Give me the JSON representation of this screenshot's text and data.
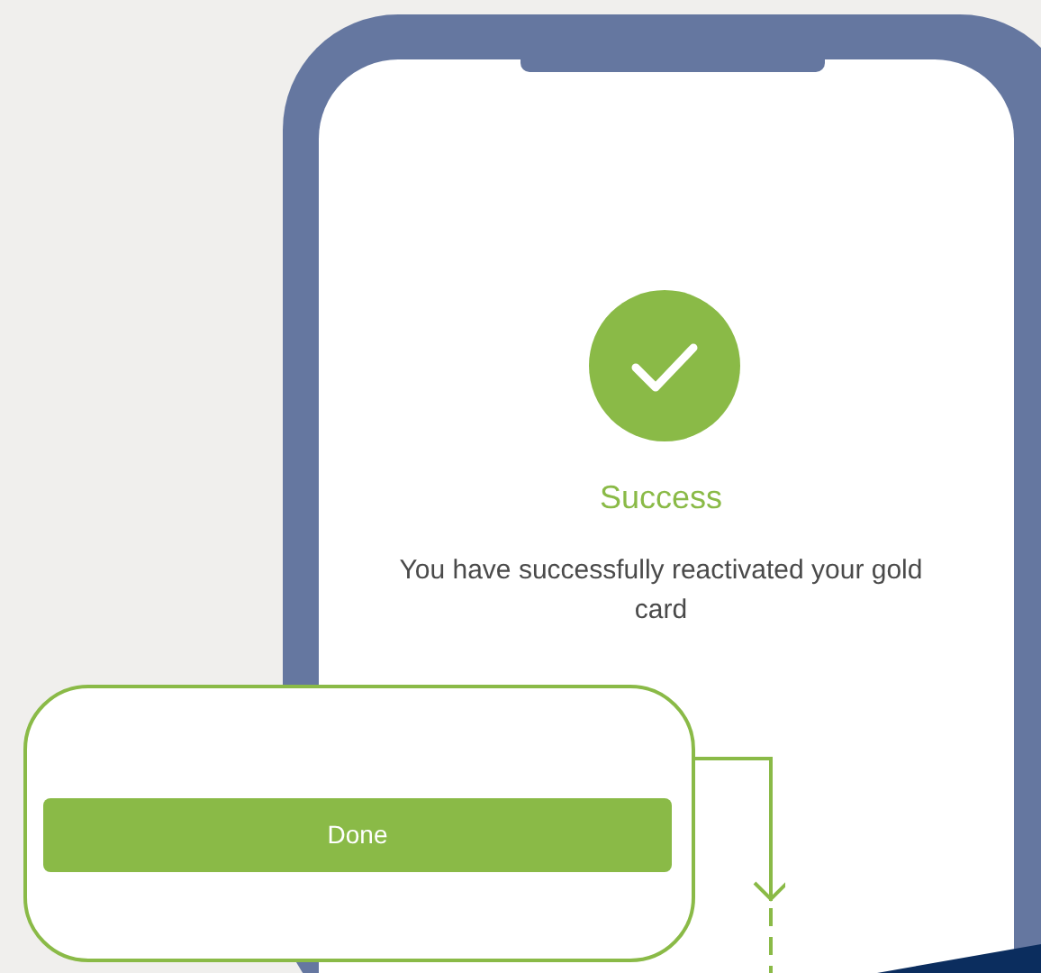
{
  "screen": {
    "title": "Success",
    "message": "You have successfully reactivated your gold card"
  },
  "callout": {
    "button": "Done"
  }
}
